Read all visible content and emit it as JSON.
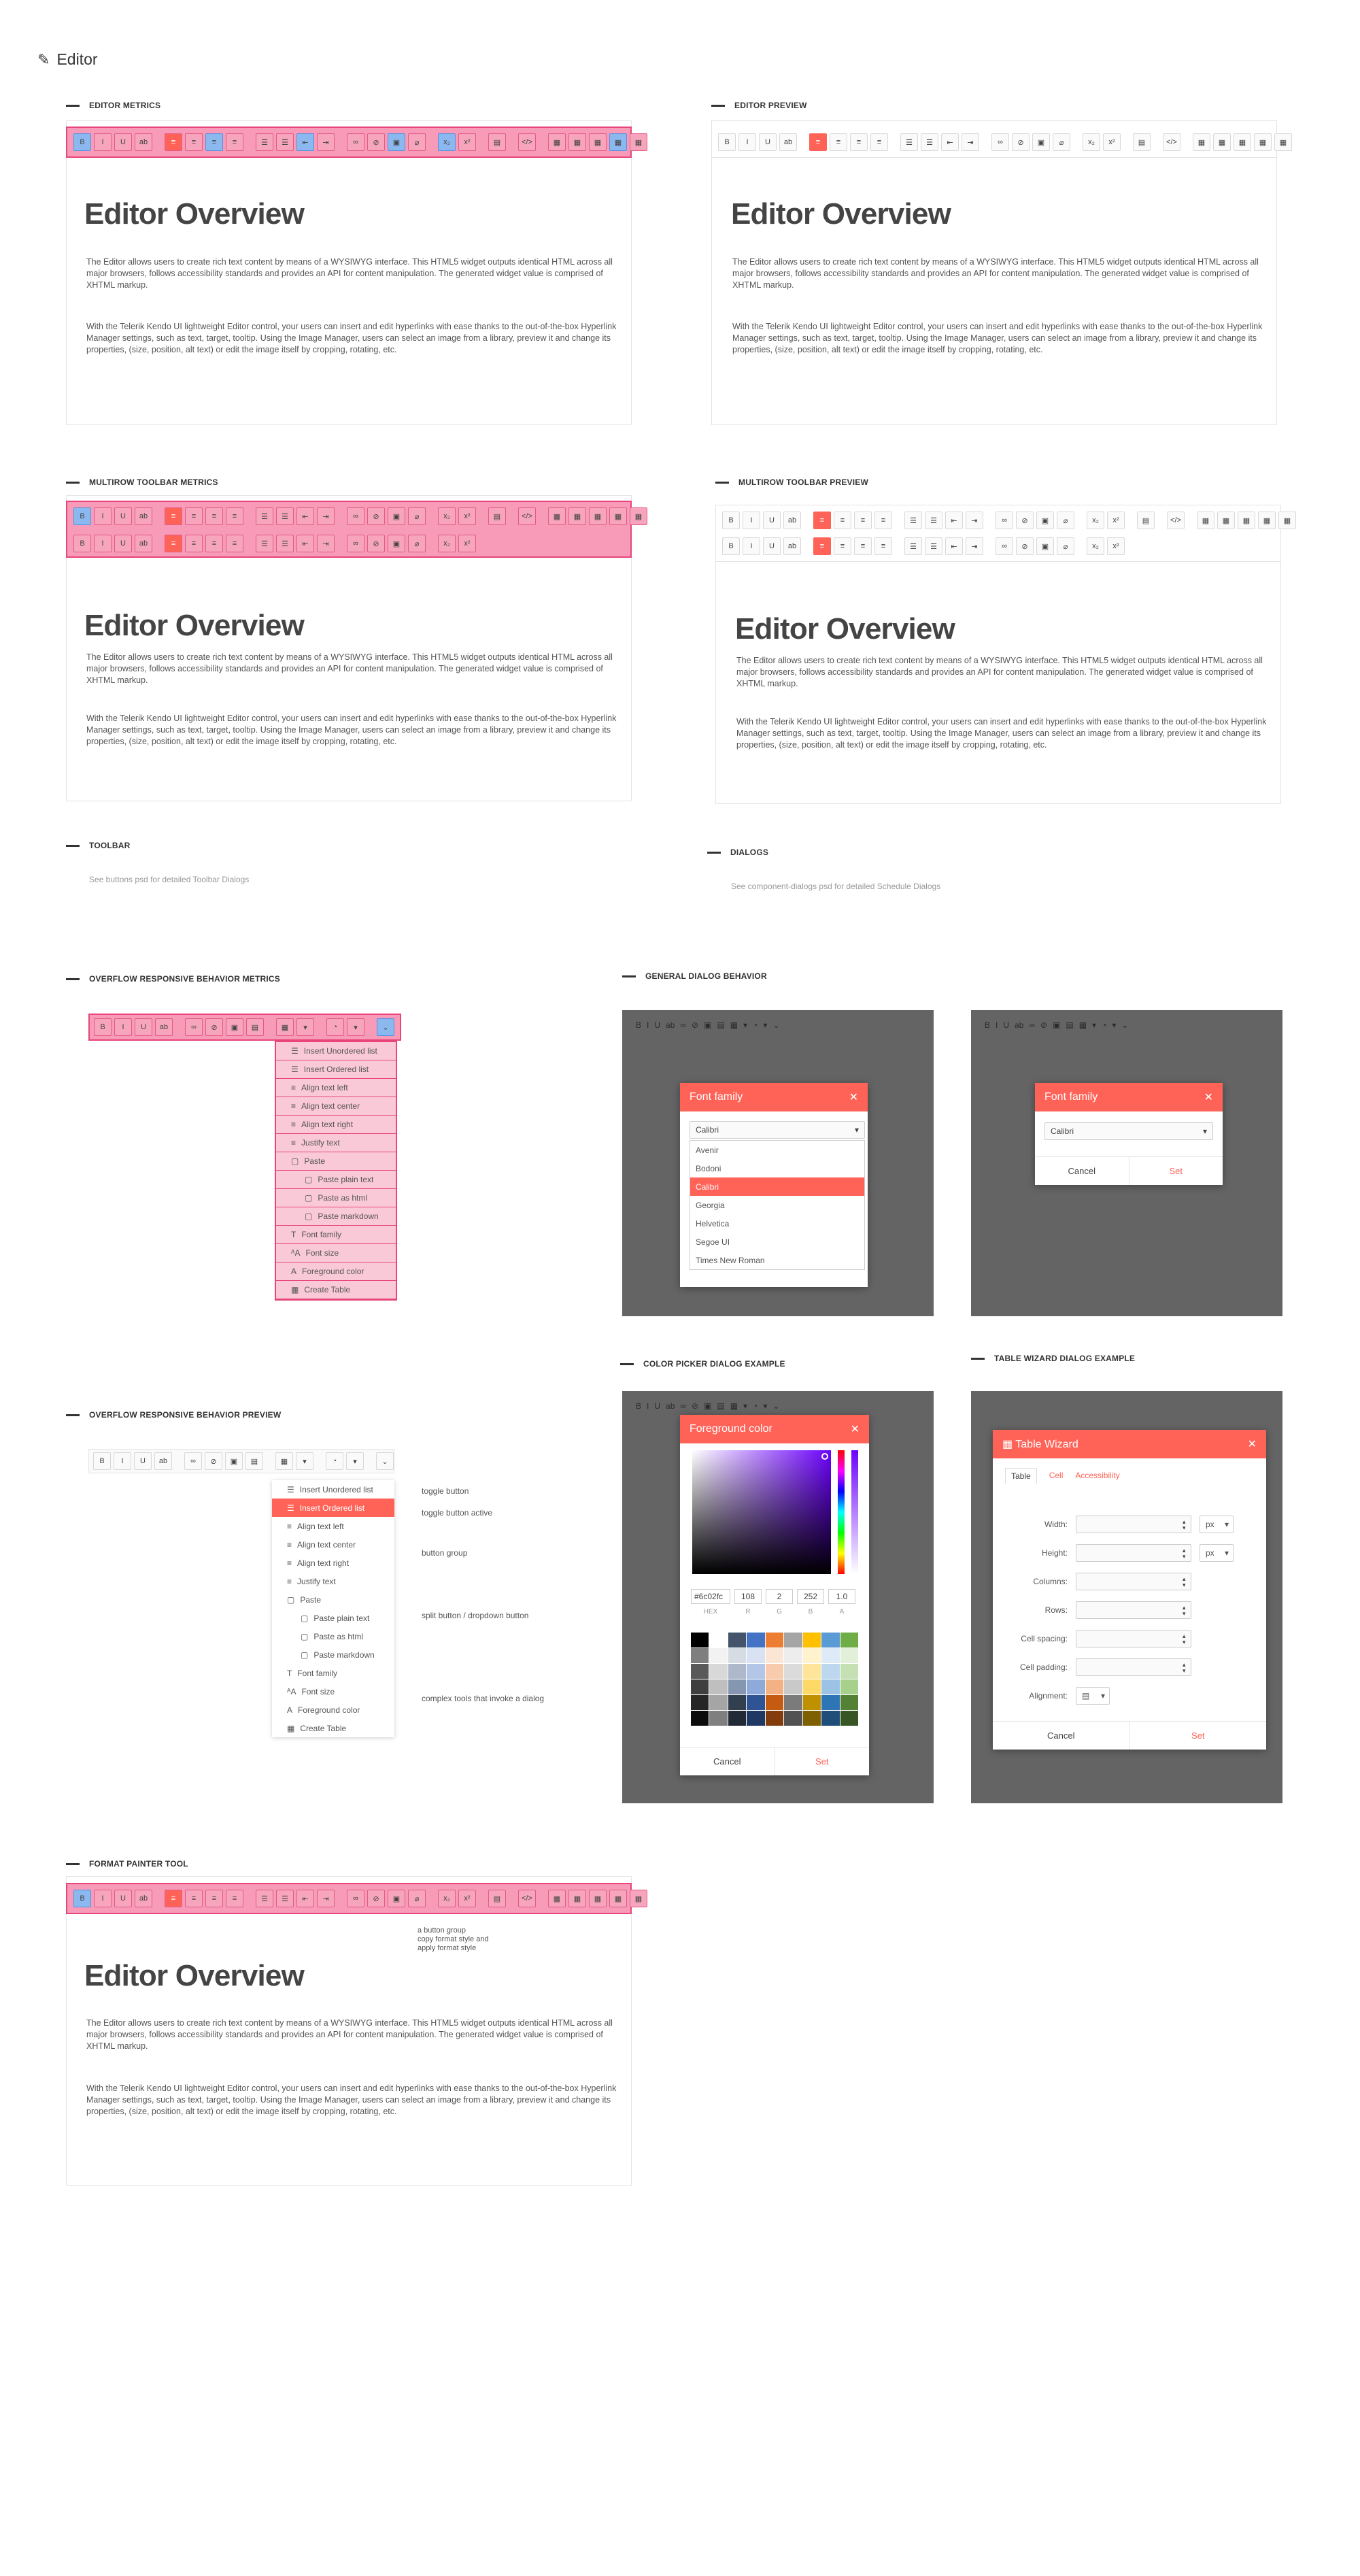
{
  "page_title": "Editor",
  "sections": {
    "editor_metrics": "EDITOR METRICS",
    "editor_preview": "EDITOR PREVIEW",
    "multirow_metrics": "MULTIROW TOOLBAR METRICS",
    "multirow_preview": "MULTIROW TOOLBAR PREVIEW",
    "toolbar": "TOOLBAR",
    "dialogs": "DIALOGS",
    "overflow_metrics": "OVERFLOW RESPONSIVE BEHAVIOR METRICS",
    "general_dialog": "GENERAL DIALOG BEHAVIOR",
    "color_picker": "COLOR PICKER DIALOG EXAMPLE",
    "table_wizard": "TABLE WIZARD DIALOG EXAMPLE",
    "overflow_preview": "OVERFLOW RESPONSIVE BEHAVIOR PREVIEW",
    "format_painter": "FORMAT PAINTER TOOL"
  },
  "content": {
    "heading": "Editor Overview",
    "p1": "The Editor allows users to create rich text content by means of a WYSIWYG interface. This HTML5 widget outputs identical HTML across all major browsers, follows accessibility standards and provides an API for content manipulation. The generated widget value is comprised of XHTML markup.",
    "p2": "With the Telerik Kendo UI lightweight Editor control, your users can insert and edit hyperlinks with ease thanks to the out-of-the-box Hyperlink Manager settings, such as text, target, tooltip. Using the Image Manager, users can select an image from a library, preview it and change its properties, (size, position, alt text) or edit the image itself by cropping, rotating, etc."
  },
  "notes": {
    "toolbar": "See buttons psd for detailed Toolbar Dialogs",
    "dialogs": "See component-dialogs psd for detailed Schedule Dialogs"
  },
  "toolbar_glyphs": [
    "B",
    "I",
    "U",
    "ab",
    "≡",
    "≡",
    "≡",
    "≡",
    "☰",
    "☰",
    "⇤",
    "⇥",
    "∞",
    "⊘",
    "▣",
    "⌀",
    "x₂",
    "x²",
    "▤",
    "</>",
    "▦",
    "▦",
    "▦",
    "▦",
    "▦"
  ],
  "overflow_menu": [
    {
      "label": "Insert Unordered list",
      "icon": "☰"
    },
    {
      "label": "Insert Ordered list",
      "icon": "☰"
    },
    {
      "label": "Align text left",
      "icon": "≡"
    },
    {
      "label": "Align text center",
      "icon": "≡"
    },
    {
      "label": "Align text right",
      "icon": "≡"
    },
    {
      "label": "Justify text",
      "icon": "≡"
    },
    {
      "label": "Paste",
      "icon": "▢"
    },
    {
      "label": "Paste plain text",
      "icon": "▢"
    },
    {
      "label": "Paste as html",
      "icon": "▢"
    },
    {
      "label": "Paste markdown",
      "icon": "▢"
    },
    {
      "label": "Font family",
      "icon": "T"
    },
    {
      "label": "Font size",
      "icon": "ᴬA"
    },
    {
      "label": "Foreground color",
      "icon": "A"
    },
    {
      "label": "Create Table",
      "icon": "▦"
    }
  ],
  "annotations": {
    "toggle": "toggle button",
    "toggle_active": "toggle button active",
    "group": "button group",
    "split": "split button / dropdown button",
    "complex": "complex tools that invoke a dialog",
    "painter": "a button group\ncopy format style and\napply format style"
  },
  "font_dialog": {
    "title": "Font family",
    "value": "Calibri",
    "options": [
      "Avenir",
      "Bodoni",
      "Calibri",
      "Georgia",
      "Helvetica",
      "Segoe UI",
      "Times New Roman"
    ],
    "selected_index": 2,
    "cancel": "Cancel",
    "set": "Set"
  },
  "color_dialog": {
    "title": "Foreground color",
    "hex": "#6c02fc",
    "r": "108",
    "g": "2",
    "b": "252",
    "a": "1.0",
    "labels": [
      "HEX",
      "R",
      "G",
      "B",
      "A"
    ],
    "cancel": "Cancel",
    "set": "Set"
  },
  "table_dialog": {
    "title": "Table Wizard",
    "tabs": [
      "Table",
      "Cell",
      "Accessibility"
    ],
    "fields": [
      "Width:",
      "Height:",
      "Columns:",
      "Rows:",
      "Cell spacing:",
      "Cell padding:",
      "Alignment:"
    ],
    "unit": "px",
    "cancel": "Cancel",
    "set": "Set"
  },
  "palette": [
    "#000000",
    "#ffffff",
    "#44546a",
    "#4472c4",
    "#ed7d31",
    "#a5a5a5",
    "#ffc000",
    "#5b9bd5",
    "#70ad47",
    "#7f7f7f",
    "#f2f2f2",
    "#d6dce4",
    "#d9e2f3",
    "#fbe5d5",
    "#ededed",
    "#fff2cc",
    "#deebf6",
    "#e2efd9",
    "#595959",
    "#d8d8d8",
    "#adb9ca",
    "#b4c6e7",
    "#f7cbac",
    "#dbdbdb",
    "#fee599",
    "#bdd7ee",
    "#c5e0b3",
    "#3f3f3f",
    "#bfbfbf",
    "#8496b0",
    "#8eaadb",
    "#f4b183",
    "#c9c9c9",
    "#ffd965",
    "#9cc3e5",
    "#a8d08d",
    "#262626",
    "#a5a5a5",
    "#323f4f",
    "#2f5496",
    "#c55a11",
    "#7b7b7b",
    "#bf9000",
    "#2e75b5",
    "#538135",
    "#0c0c0c",
    "#7f7f7f",
    "#222a35",
    "#1f3864",
    "#833c0b",
    "#525252",
    "#7f6000",
    "#1e4e79",
    "#375623"
  ]
}
